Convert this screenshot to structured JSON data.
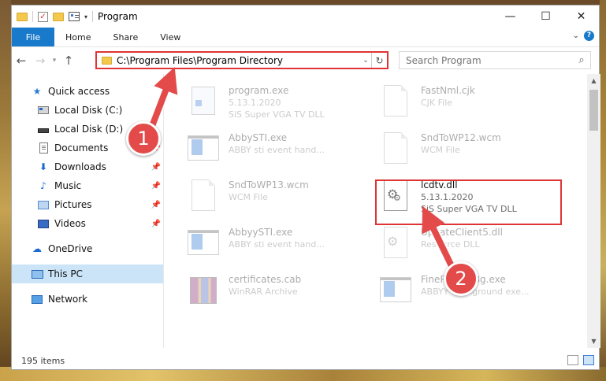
{
  "window": {
    "title": "Program",
    "controls": {
      "minimize": "—",
      "maximize": "☐",
      "close": "✕"
    }
  },
  "ribbon": {
    "tabs": [
      {
        "label": "File"
      },
      {
        "label": "Home"
      },
      {
        "label": "Share"
      },
      {
        "label": "View"
      }
    ]
  },
  "address_bar": {
    "path": "C:\\Program Files\\Program Directory"
  },
  "search": {
    "placeholder": "Search Program"
  },
  "nav_pane": {
    "quick_access": "Quick access",
    "items": [
      {
        "label": "Local Disk (C:)",
        "icon": "local-disk-c-icon",
        "pinned": false
      },
      {
        "label": "Local Disk (D:)",
        "icon": "local-disk-d-icon",
        "pinned": false
      },
      {
        "label": "Documents",
        "icon": "documents-icon",
        "pinned": true
      },
      {
        "label": "Downloads",
        "icon": "downloads-icon",
        "pinned": true
      },
      {
        "label": "Music",
        "icon": "music-icon",
        "pinned": true
      },
      {
        "label": "Pictures",
        "icon": "pictures-icon",
        "pinned": true
      },
      {
        "label": "Videos",
        "icon": "videos-icon",
        "pinned": true
      }
    ],
    "onedrive": "OneDrive",
    "this_pc": "This PC",
    "network": "Network"
  },
  "files": [
    {
      "name": "program.exe",
      "line2": "5.13.1.2020",
      "line3": "SiS Super VGA TV DLL",
      "type": "exe"
    },
    {
      "name": "FastNml.cjk",
      "line2": "CJK File",
      "line3": "",
      "type": "doc"
    },
    {
      "name": "AbbySTI.exe",
      "line2": "ABBY sti event hand...",
      "line3": "",
      "type": "app"
    },
    {
      "name": "SndToWP12.wcm",
      "line2": "WCM File",
      "line3": "",
      "type": "doc"
    },
    {
      "name": "SndToWP13.wcm",
      "line2": "WCM File",
      "line3": "",
      "type": "doc"
    },
    {
      "name": "lcdtv.dll",
      "line2": "5.13.1.2020",
      "line3": "SiS Super VGA TV DLL",
      "type": "dll"
    },
    {
      "name": "AbbyySTI.exe",
      "line2": "ABBY sti event hand...",
      "line3": "",
      "type": "app"
    },
    {
      "name": "UpdateClient5.dll",
      "line2": "Resource DLL",
      "line3": "",
      "type": "dll"
    },
    {
      "name": "certificates.cab",
      "line2": "WinRAR Archive",
      "line3": "",
      "type": "cab"
    },
    {
      "name": "FineReaderBg.exe",
      "line2": "ABBYY background exe...",
      "line3": "",
      "type": "app"
    }
  ],
  "status": {
    "item_count": "195 items"
  },
  "annotations": {
    "badge_1": "1",
    "badge_2": "2",
    "color": "#e34b4b"
  }
}
